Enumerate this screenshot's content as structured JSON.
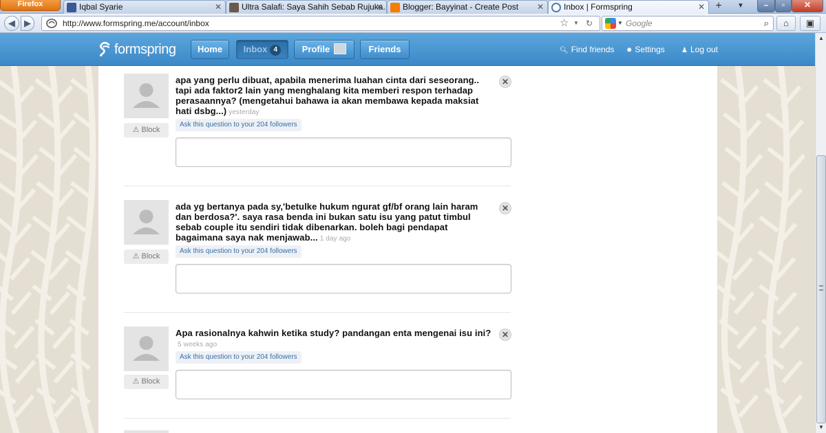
{
  "browser": {
    "firefox_label": "Firefox",
    "tabs": [
      {
        "title": "Iqbal Syarie"
      },
      {
        "title": "Ultra Salafi: Saya Sahih Sebab Rujuka..."
      },
      {
        "title": "Blogger: Bayyinat - Create Post"
      },
      {
        "title": "Inbox | Formspring"
      }
    ],
    "url": "http://www.formspring.me/account/inbox",
    "search_placeholder": "Google"
  },
  "site": {
    "logo": "formspring",
    "nav": {
      "home": "Home",
      "inbox": "Inbox",
      "inbox_count": "4",
      "profile": "Profile",
      "friends": "Friends"
    },
    "links": {
      "find_friends": "Find friends",
      "settings": "Settings",
      "logout": "Log out"
    }
  },
  "questions": [
    {
      "text": "apa yang perlu dibuat, apabila menerima luahan cinta dari seseorang.. tapi ada faktor2 lain yang menghalang kita memberi respon terhadap perasaannya? (mengetahui bahawa ia akan membawa kepada maksiat hati dsbg...)",
      "time": "yesterday",
      "ask_label": "Ask this question to your 204 followers",
      "block_label": "Block"
    },
    {
      "text": "ada yg bertanya pada sy,'betulke hukum ngurat gf/bf orang lain haram dan berdosa?'. saya rasa benda ini bukan satu isu yang patut timbul sebab couple itu sendiri tidak dibenarkan. boleh bagi pendapat bagaimana saya nak menjawab...",
      "time": "1 day ago",
      "ask_label": "Ask this question to your 204 followers",
      "block_label": "Block"
    },
    {
      "text": "Apa rasionalnya kahwin ketika study? pandangan enta mengenai isu ini?",
      "time": "5 weeks ago",
      "ask_label": "Ask this question to your 204 followers",
      "block_label": "Block"
    }
  ],
  "colors": {
    "header_blue": "#3c88c8",
    "link_blue": "#3a6ea5",
    "background": "#e8e3d9"
  }
}
